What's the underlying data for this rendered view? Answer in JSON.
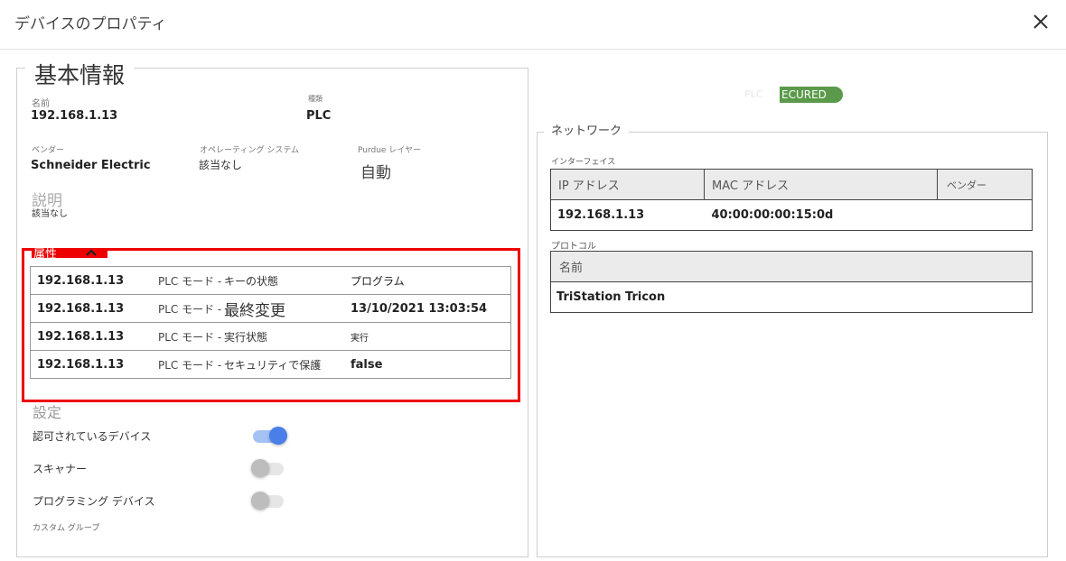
{
  "dialog": {
    "title": "デバイスのプロパティ",
    "close_icon": "close-icon"
  },
  "basic": {
    "title": "基本情報",
    "name_label": "名前",
    "name_value": "192.168.1.13",
    "type_label": "種類",
    "type_value": "PLC",
    "vendor_label": "ベンダー",
    "vendor_value": "Schneider Electric",
    "os_label": "オペレーティング システム",
    "os_value": "該当なし",
    "purdue_label": "Purdue レイヤー",
    "purdue_value": "自動",
    "description_heading": "説明",
    "description_value": "該当なし"
  },
  "attributes": {
    "tab_label": "属性",
    "rows": [
      {
        "ip": "192.168.1.13",
        "mode": "PLC モード -",
        "key": "キーの状態",
        "value": "プログラム"
      },
      {
        "ip": "192.168.1.13",
        "mode": "PLC モード -",
        "key": "最終変更",
        "value": "13/10/2021 13:03:54"
      },
      {
        "ip": "192.168.1.13",
        "mode": "PLC モード -",
        "key": "実行状態",
        "value": "実行"
      },
      {
        "ip": "192.168.1.13",
        "mode": "PLC モード -",
        "key": "セキュリティで保護",
        "value": "false"
      }
    ]
  },
  "settings": {
    "heading": "設定",
    "authorized_label": "認可されているデバイス",
    "authorized_on": true,
    "scanner_label": "スキャナー",
    "scanner_on": false,
    "programming_label": "プログラミング デバイス",
    "programming_on": false,
    "custom_group_label": "カスタム グループ"
  },
  "status": {
    "faint_text": "PLC",
    "badge_text": "ECURED",
    "badge_color": "#5a9a4a"
  },
  "network": {
    "title": "ネットワーク",
    "interfaces_label": "インターフェイス",
    "interface_headers": [
      "IP アドレス",
      "MAC アドレス",
      "ベンダー"
    ],
    "interface_rows": [
      {
        "ip": "192.168.1.13",
        "mac": "40:00:00:00:15:0d",
        "vendor": ""
      }
    ],
    "protocols_label": "プロトコル",
    "protocol_header": "名前",
    "protocol_rows": [
      {
        "name": "TriStation Tricon"
      }
    ]
  }
}
